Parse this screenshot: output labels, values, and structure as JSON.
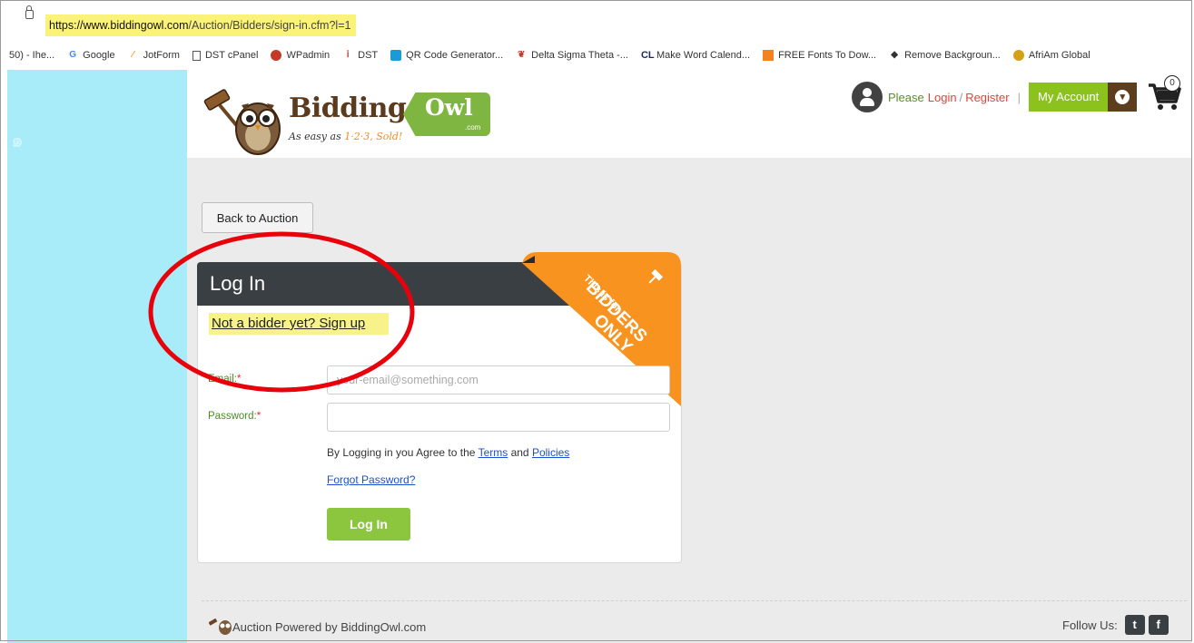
{
  "browser": {
    "url_host": "https://www.biddingowl.com",
    "url_path": "/Auction/Bidders/sign-in.cfm?l=1",
    "bookmarks": [
      {
        "label": "50) - Ihe...",
        "icon": ""
      },
      {
        "label": "Google",
        "icon": "google-icon"
      },
      {
        "label": "JotForm",
        "icon": "jotform-icon"
      },
      {
        "label": "DST cPanel",
        "icon": "page-icon"
      },
      {
        "label": "WPadmin",
        "icon": "wp-icon"
      },
      {
        "label": "DST",
        "icon": "dst-icon"
      },
      {
        "label": "QR Code Generator...",
        "icon": "qr-icon"
      },
      {
        "label": "Delta Sigma Theta -...",
        "icon": "delta-icon"
      },
      {
        "label": "Make Word Calend...",
        "icon": "cl-icon"
      },
      {
        "label": "FREE Fonts To Dow...",
        "icon": "fonts-icon"
      },
      {
        "label": "Remove Backgroun...",
        "icon": "remove-bg-icon"
      },
      {
        "label": "AfriAm Global",
        "icon": "afriam-icon"
      }
    ]
  },
  "header": {
    "logo_brand": "Bidding",
    "logo_tag": "Owl",
    "logo_tag_sub": ".com",
    "logo_slogan_prefix": "As easy as ",
    "logo_slogan_em": "1·2·3, Sold!",
    "please_text": "Please",
    "login_link": "Login",
    "slash": "/",
    "register_link": "Register",
    "pipe": "|",
    "my_account": "My Account",
    "cart_count": "0"
  },
  "main": {
    "back_button": "Back to Auction",
    "card_title": "Log In",
    "signup_link": "Not a bidder yet? Sign up",
    "ribbon_line1": "This is for",
    "ribbon_line2": "BIDDERS",
    "ribbon_line3": "ONLY",
    "email_label": "Email:",
    "email_placeholder": "your-email@something.com",
    "password_label": "Password:",
    "required_mark": "*",
    "agree_prefix": "By Logging in you Agree to the ",
    "terms_link": "Terms",
    "agree_and": " and ",
    "policies_link": "Policies",
    "forgot_link": "Forgot Password?",
    "login_button": "Log In"
  },
  "footer": {
    "powered_by": "Auction Powered by BiddingOwl.com",
    "follow_us": "Follow Us:",
    "twitter_glyph": "t",
    "facebook_glyph": "f"
  },
  "colors": {
    "accent_green": "#8cc21e",
    "brown": "#5c3d1e",
    "ribbon_orange": "#f7931e",
    "highlight_yellow": "#f7f38a",
    "annotation_red": "#e8000b"
  }
}
